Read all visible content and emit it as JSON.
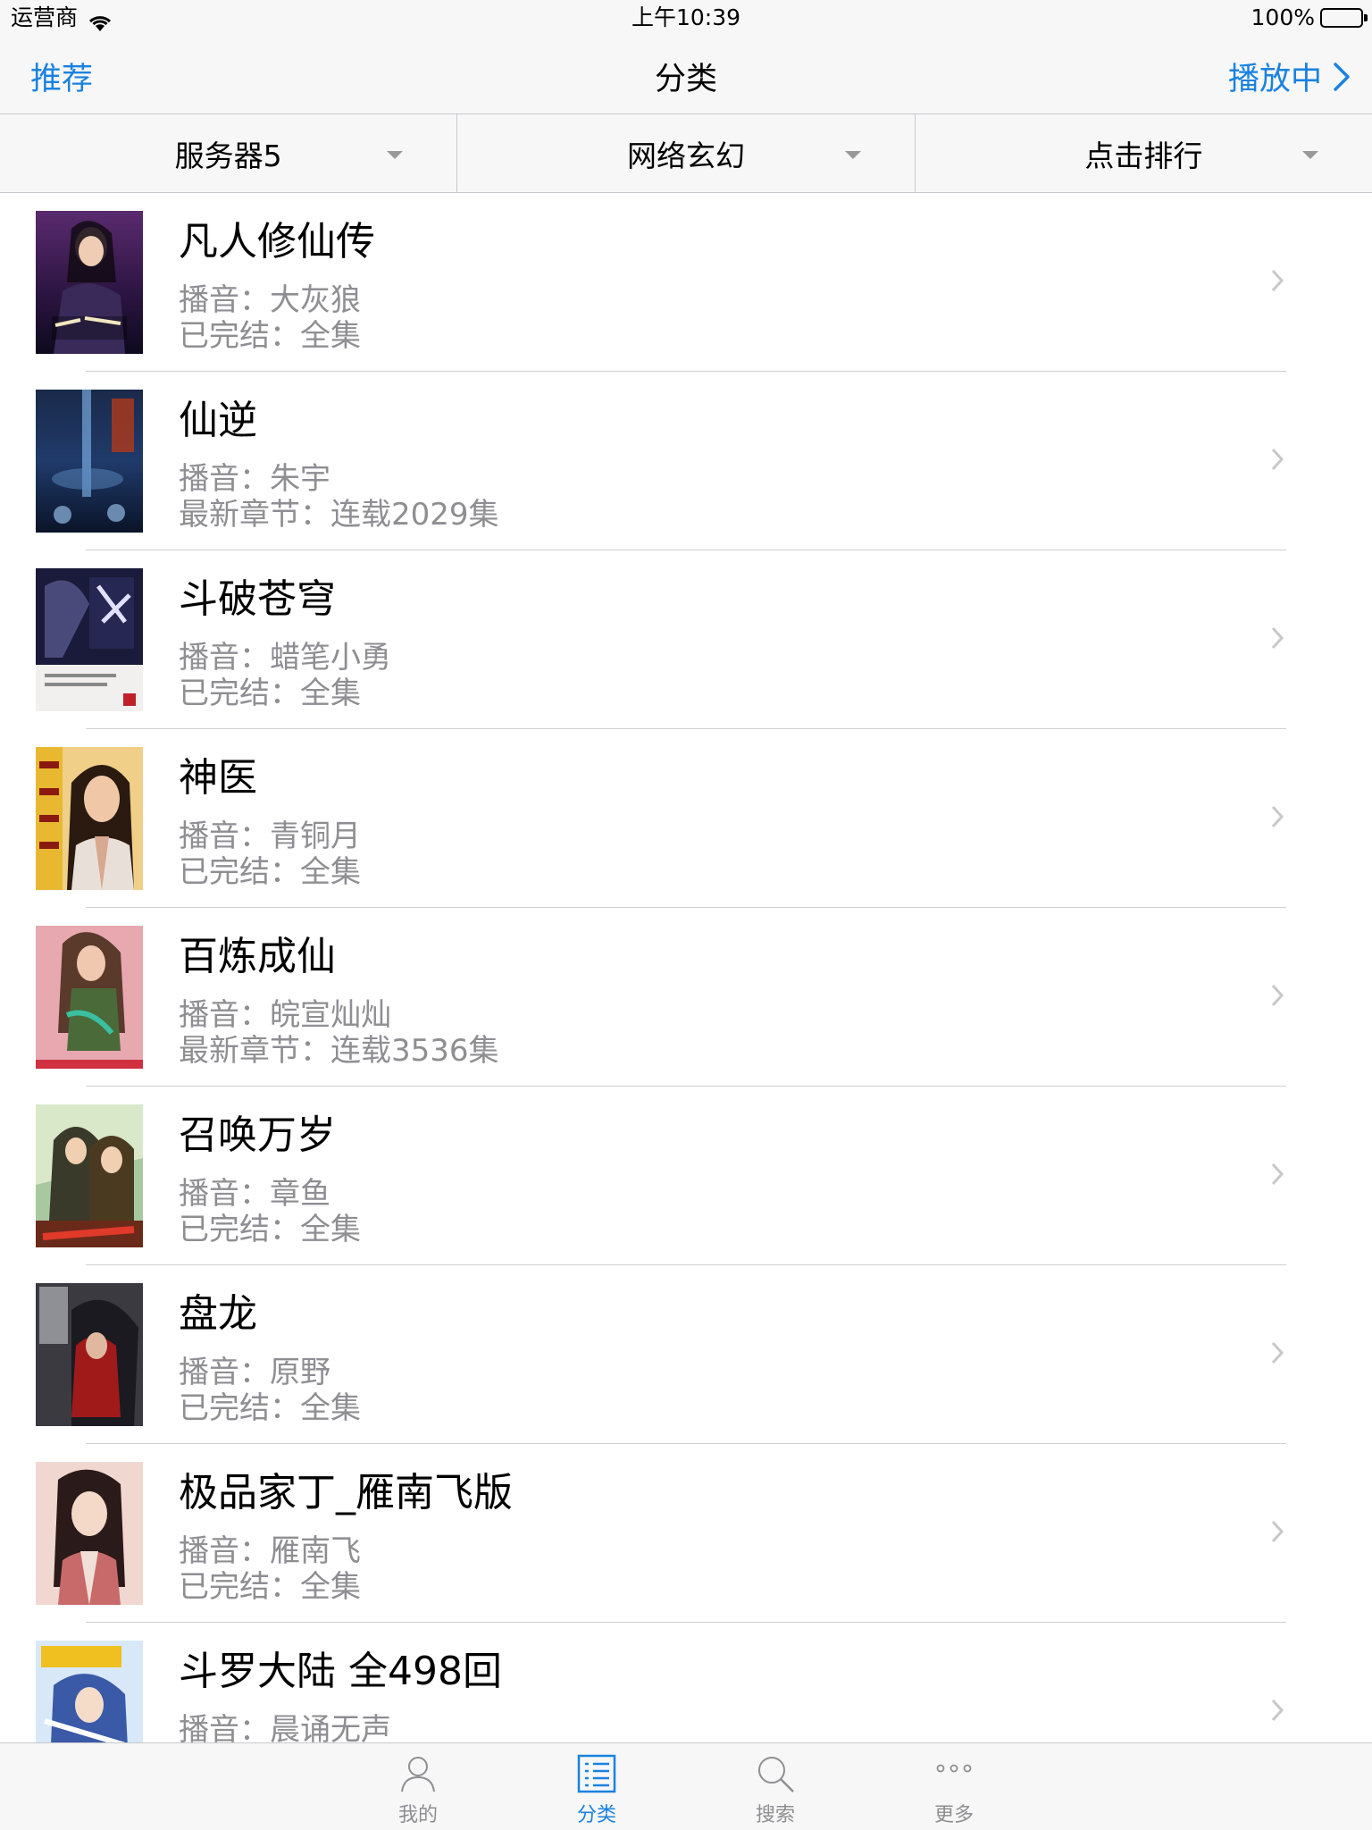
{
  "status_bar": {
    "carrier": "运营商",
    "time": "上午10:39",
    "battery": "100%"
  },
  "nav": {
    "left": "推荐",
    "title": "分类",
    "right": "播放中"
  },
  "filters": [
    {
      "label": "服务器5"
    },
    {
      "label": "网络玄幻"
    },
    {
      "label": "点击排行"
    }
  ],
  "books": [
    {
      "title": "凡人修仙传",
      "line1": "播音：大灰狼",
      "line2": "已完结：全集"
    },
    {
      "title": "仙逆",
      "line1": "播音：朱宇",
      "line2": "最新章节：连载2029集"
    },
    {
      "title": "斗破苍穹",
      "line1": "播音：蜡笔小勇",
      "line2": "已完结：全集"
    },
    {
      "title": "神医",
      "line1": "播音：青铜月",
      "line2": "已完结：全集"
    },
    {
      "title": "百炼成仙",
      "line1": "播音：皖宣灿灿",
      "line2": "最新章节：连载3536集"
    },
    {
      "title": "召唤万岁",
      "line1": "播音：章鱼",
      "line2": "已完结：全集"
    },
    {
      "title": "盘龙",
      "line1": "播音：原野",
      "line2": "已完结：全集"
    },
    {
      "title": "极品家丁_雁南飞版",
      "line1": "播音：雁南飞",
      "line2": "已完结：全集"
    },
    {
      "title": "斗罗大陆 全498回",
      "line1": "播音：晨诵无声",
      "line2": ""
    }
  ],
  "tabs": [
    {
      "label": "我的",
      "icon": "person-icon"
    },
    {
      "label": "分类",
      "icon": "list-icon"
    },
    {
      "label": "搜索",
      "icon": "search-icon"
    },
    {
      "label": "更多",
      "icon": "more-icon"
    }
  ],
  "colors": {
    "accent": "#1a82e0",
    "secondary_text": "#8e8e93",
    "separator": "#c8c7cc"
  }
}
